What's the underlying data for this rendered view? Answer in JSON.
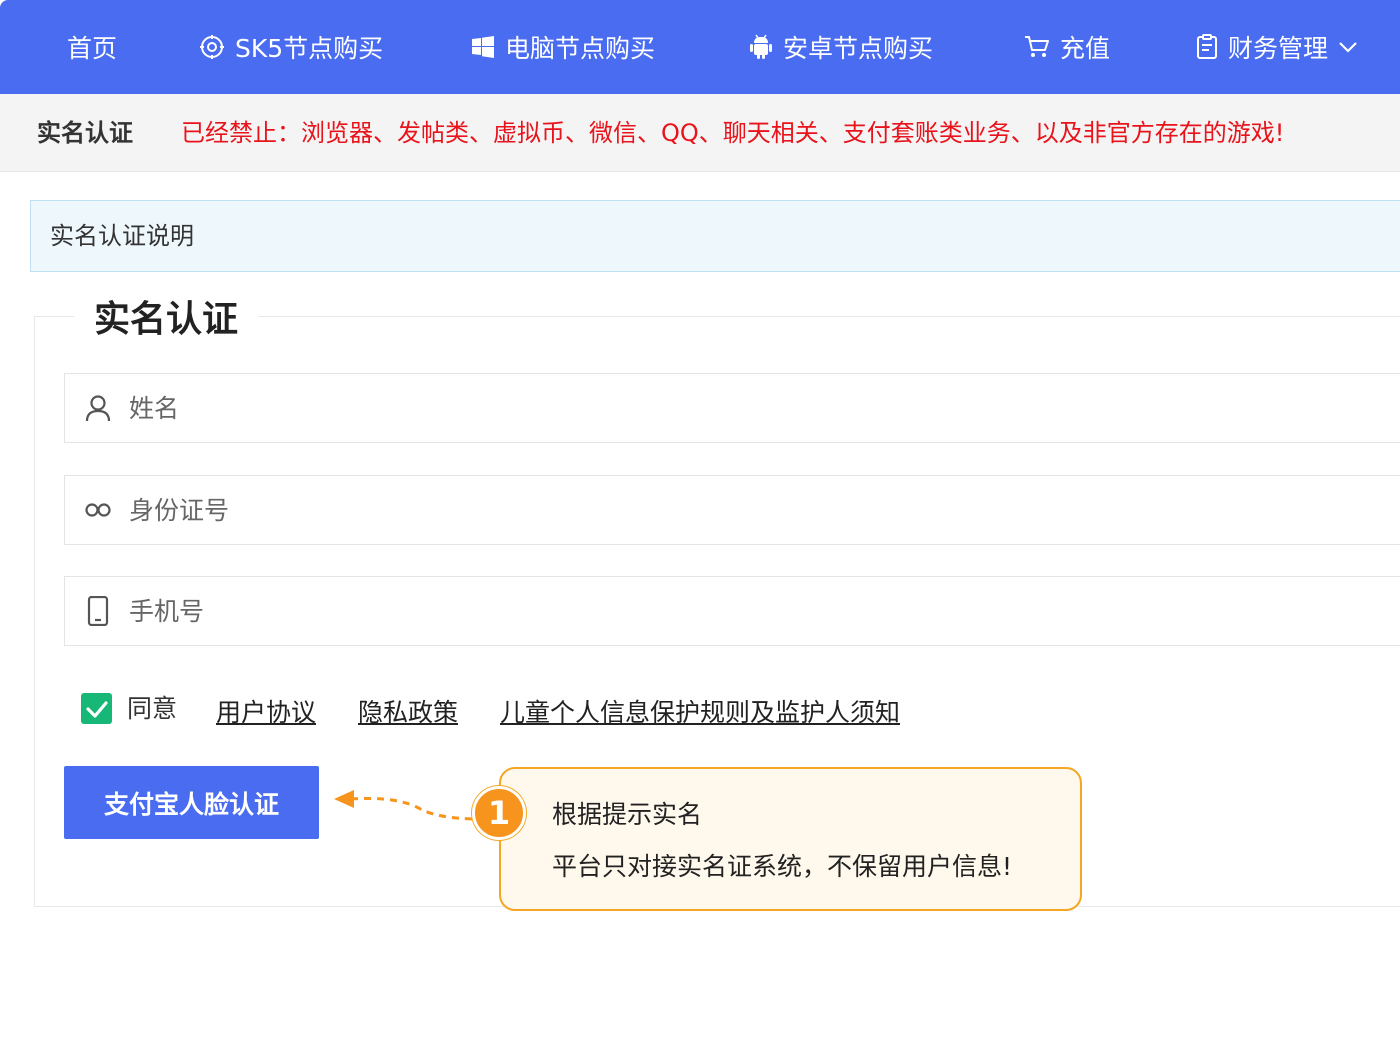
{
  "nav": {
    "items": [
      {
        "label": "首页",
        "icon": ""
      },
      {
        "label": "SK5节点购买",
        "icon": "node-icon"
      },
      {
        "label": "电脑节点购买",
        "icon": "windows-icon"
      },
      {
        "label": "安卓节点购买",
        "icon": "android-icon"
      },
      {
        "label": "充值",
        "icon": "cart-icon"
      },
      {
        "label": "财务管理",
        "icon": "finance-icon",
        "dropdown": "chevron-down-icon"
      }
    ]
  },
  "notice": {
    "title": "实名认证",
    "text": "已经禁止：浏览器、发帖类、虚拟币、微信、QQ、聊天相关、支付套账类业务、以及非官方存在的游戏!"
  },
  "info": {
    "text": "实名认证说明"
  },
  "form": {
    "legend": "实名认证",
    "name_placeholder": "姓名",
    "id_placeholder": "身份证号",
    "phone_placeholder": "手机号",
    "agree_label": "同意",
    "agree_checked": true,
    "links": [
      "用户协议",
      "隐私政策",
      "儿童个人信息保护规则及监护人须知"
    ],
    "submit_label": "支付宝人脸认证"
  },
  "callout": {
    "step": "1",
    "line1": "根据提示实名",
    "line2": "平台只对接实名证系统，不保留用户信息!"
  },
  "colors": {
    "brand": "#4a6cf0",
    "notice_red": "#e8131b",
    "checkbox_green": "#16b777",
    "callout_orange": "#f5a623"
  }
}
